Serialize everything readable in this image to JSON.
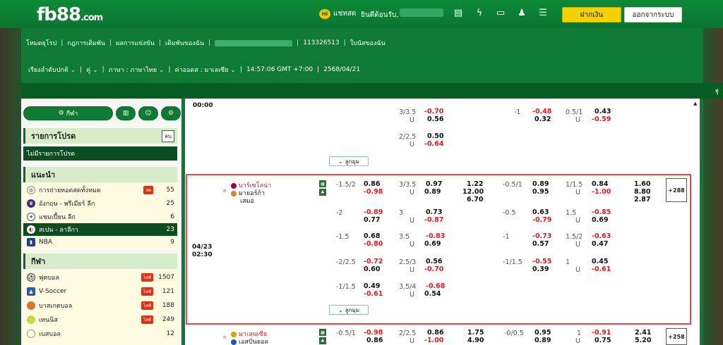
{
  "topbar": {
    "logo": "fb88",
    "logo_suffix": ".com",
    "chat_label": "แชทสด",
    "chat_badge": "Hi",
    "welcome": "ยินดีต้อนรับ,",
    "deposit": "ฝากเงิน",
    "logout": "ออกจากระบบ",
    "icons": [
      "wallet-icon",
      "flash-icon",
      "promotion-icon",
      "user-icon",
      "list-icon"
    ]
  },
  "nav": {
    "items": [
      "โหมดยุโรป",
      "กฎการเดิมพัน",
      "ผลการแข่งขัน",
      "เดิมพันของฉัน"
    ],
    "account_id": "113326513",
    "statement": "ใบนัสของฉัน"
  },
  "filters": {
    "sort": "เรียงลำดับปกติ",
    "pair": "คู่",
    "language": "ภาษา : ภาษาไทย",
    "odds_type": "ค่าออดส : มาเลเซีย",
    "clock": "14:57:06 GMT +7:00",
    "date": "2568/04/21"
  },
  "strip_text": "รี",
  "sidebar": {
    "sport_button": "กีฬา",
    "parlay_title": "รายการโปรด",
    "parlay_toggle": "ลบ",
    "no_parlay": "ไม่มีรายการโปรด",
    "recommended_title": "แนะนำ",
    "recommended": [
      {
        "name": "การถ่ายทอดสดทั้งหมด",
        "count": "55",
        "live": "สด"
      },
      {
        "name": "อังกฤษ - พรีเมียร์ ลีก",
        "count": "25",
        "live": ""
      },
      {
        "name": "แชมเปี้ยน ลีก",
        "count": "6",
        "live": ""
      },
      {
        "name": "สเปน - ลาลีกา",
        "count": "23",
        "live": ""
      },
      {
        "name": "NBA",
        "count": "9",
        "live": ""
      }
    ],
    "sports_title": "กีฬา",
    "sports": [
      {
        "name": "ฟุตบอล",
        "count": "1507",
        "live": "ไลฟ์"
      },
      {
        "name": "V-Soccer",
        "count": "121",
        "live": "ไลฟ์"
      },
      {
        "name": "บาสเกตบอล",
        "count": "188",
        "live": "ไลฟ์"
      },
      {
        "name": "เทนนิส",
        "count": "249",
        "live": "ไลฟ์"
      },
      {
        "name": "เบสบอล",
        "count": "12",
        "live": ""
      }
    ]
  },
  "table": {
    "time0": "00:00",
    "top_rows": [
      {
        "hl": "3/3.5",
        "hlu": "U",
        "h1": "-0.70",
        "h2": "0.56",
        "a1": "-1",
        "a2": "-0.48",
        "a3": "0.32",
        "ah": "0.5/1",
        "ahu": "U",
        "ah1": "0.43",
        "ah2": "-0.59"
      },
      {
        "hl": "2/2.5",
        "hlu": "U",
        "h1": "0.50",
        "h2": "-0.64"
      }
    ],
    "more": "ลูกมุม",
    "match": {
      "date": "04/23",
      "time": "02:30",
      "home": "บาร์เซโลน่า",
      "away": "มายอร์ก้า",
      "draw": "เสมอ",
      "more_count": "+288",
      "rows": [
        {
          "hdp": "-1.5/2",
          "h1": "0.86",
          "h2": "-0.98",
          "ou": "3/3.5",
          "ouu": "U",
          "o1": "0.97",
          "o2": "0.89",
          "x1": "1.22",
          "x2": "12.00",
          "x3": "6.70",
          "fh": "-0.5/1",
          "f1": "0.89",
          "f2": "0.95",
          "fou": "1/1.5",
          "fouu": "U",
          "fo1": "0.84",
          "fo2": "-1.00",
          "fx1": "1.60",
          "fx2": "8.80",
          "fx3": "2.87"
        },
        {
          "hdp": "-2",
          "h1": "-0.89",
          "h2": "0.77",
          "ou": "3",
          "ouu": "U",
          "o1": "0.73",
          "o2": "-0.87",
          "fh": "-0.5",
          "f1": "0.63",
          "f2": "-0.79",
          "fou": "1.5",
          "fouu": "U",
          "fo1": "-0.85",
          "fo2": "0.69"
        },
        {
          "hdp": "-1.5",
          "h1": "0.68",
          "h2": "-0.80",
          "ou": "3.5",
          "ouu": "U",
          "o1": "-0.83",
          "o2": "0.69",
          "fh": "-1",
          "f1": "-0.73",
          "f2": "0.57",
          "fou": "1.5/2",
          "fouu": "U",
          "fo1": "-0.63",
          "fo2": "0.47"
        },
        {
          "hdp": "-2/2.5",
          "h1": "-0.72",
          "h2": "0.60",
          "ou": "2.5/3",
          "ouu": "U",
          "o1": "0.56",
          "o2": "-0.70",
          "fh": "-1/1.5",
          "f1": "-0.55",
          "f2": "0.39",
          "fou": "1",
          "fouu": "U",
          "fo1": "0.45",
          "fo2": "-0.61"
        },
        {
          "hdp": "-1/1.5",
          "h1": "0.49",
          "h2": "-0.61",
          "ou": "3.5/4",
          "ouu": "U",
          "o1": "-0.68",
          "o2": "0.54"
        }
      ]
    },
    "next": {
      "home": "มาเลนเซีย",
      "away": "เอสปันยอล",
      "hdp": "-0.5/1",
      "h1": "-0.98",
      "h2": "0.86",
      "ou": "2/2.5",
      "ouu": "U",
      "o1": "0.86",
      "o2": "-1.00",
      "x1": "1.75",
      "x2": "4.90",
      "fh": "-0/0.5",
      "f1": "0.95",
      "f2": "0.89",
      "fou": "1",
      "fouu": "U",
      "fo1": "-0.91",
      "fo2": "0.75",
      "fx1": "2.41",
      "fx2": "5.20",
      "more_count": "+258"
    }
  }
}
